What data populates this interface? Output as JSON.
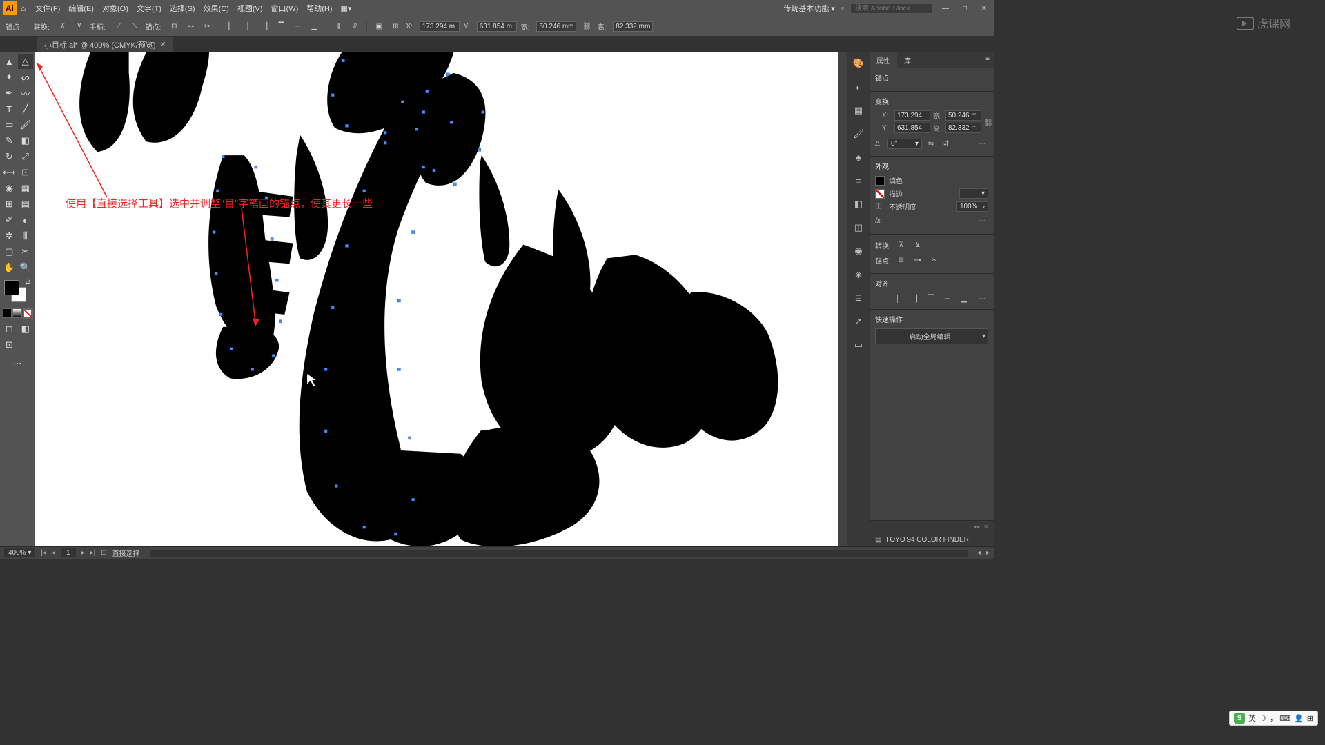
{
  "menubar": {
    "items": [
      "文件(F)",
      "编辑(E)",
      "对象(O)",
      "文字(T)",
      "选择(S)",
      "效果(C)",
      "视图(V)",
      "窗口(W)",
      "帮助(H)"
    ],
    "workspace": "传统基本功能",
    "search_placeholder": "搜索 Adobe Stock"
  },
  "optionsbar": {
    "anchor_label": "锚点",
    "convert_label": "转换:",
    "handles_label": "手柄:",
    "anchors_label": "锚点:",
    "x_label": "X:",
    "x_value": "173.294 m",
    "y_label": "Y:",
    "y_value": "631.854 m",
    "w_label": "宽:",
    "w_value": "50.246 mm",
    "h_label": "高:",
    "h_value": "82.332 mm"
  },
  "tab": {
    "title": "小目标.ai* @ 400% (CMYK/预览)"
  },
  "annotation": "使用【直接选择工具】选中并调整“目”字笔画的锚点，使其更长一些",
  "properties": {
    "tab_props": "属性",
    "tab_lib": "库",
    "anchor_section": "锚点",
    "transform_section": "变换",
    "x": "173.294",
    "y": "631.854",
    "w": "50.246 m",
    "h": "82.332 m",
    "angle_label": "Δ",
    "angle_value": "0°",
    "appearance_section": "外观",
    "fill_label": "填色",
    "stroke_label": "描边",
    "opacity_label": "不透明度",
    "opacity_value": "100%",
    "fx_label": "fx.",
    "convert_label": "转换:",
    "anchors_label": "锚点:",
    "align_section": "对齐",
    "quick_label": "快速操作",
    "global_edit": "启动全局编辑"
  },
  "color_finder": {
    "label": "TOYO 94 COLOR FINDER"
  },
  "statusbar": {
    "zoom": "400%",
    "artboard": "1",
    "tool": "直接选择"
  },
  "ime": {
    "lang": "英"
  },
  "watermark": "虎课网"
}
